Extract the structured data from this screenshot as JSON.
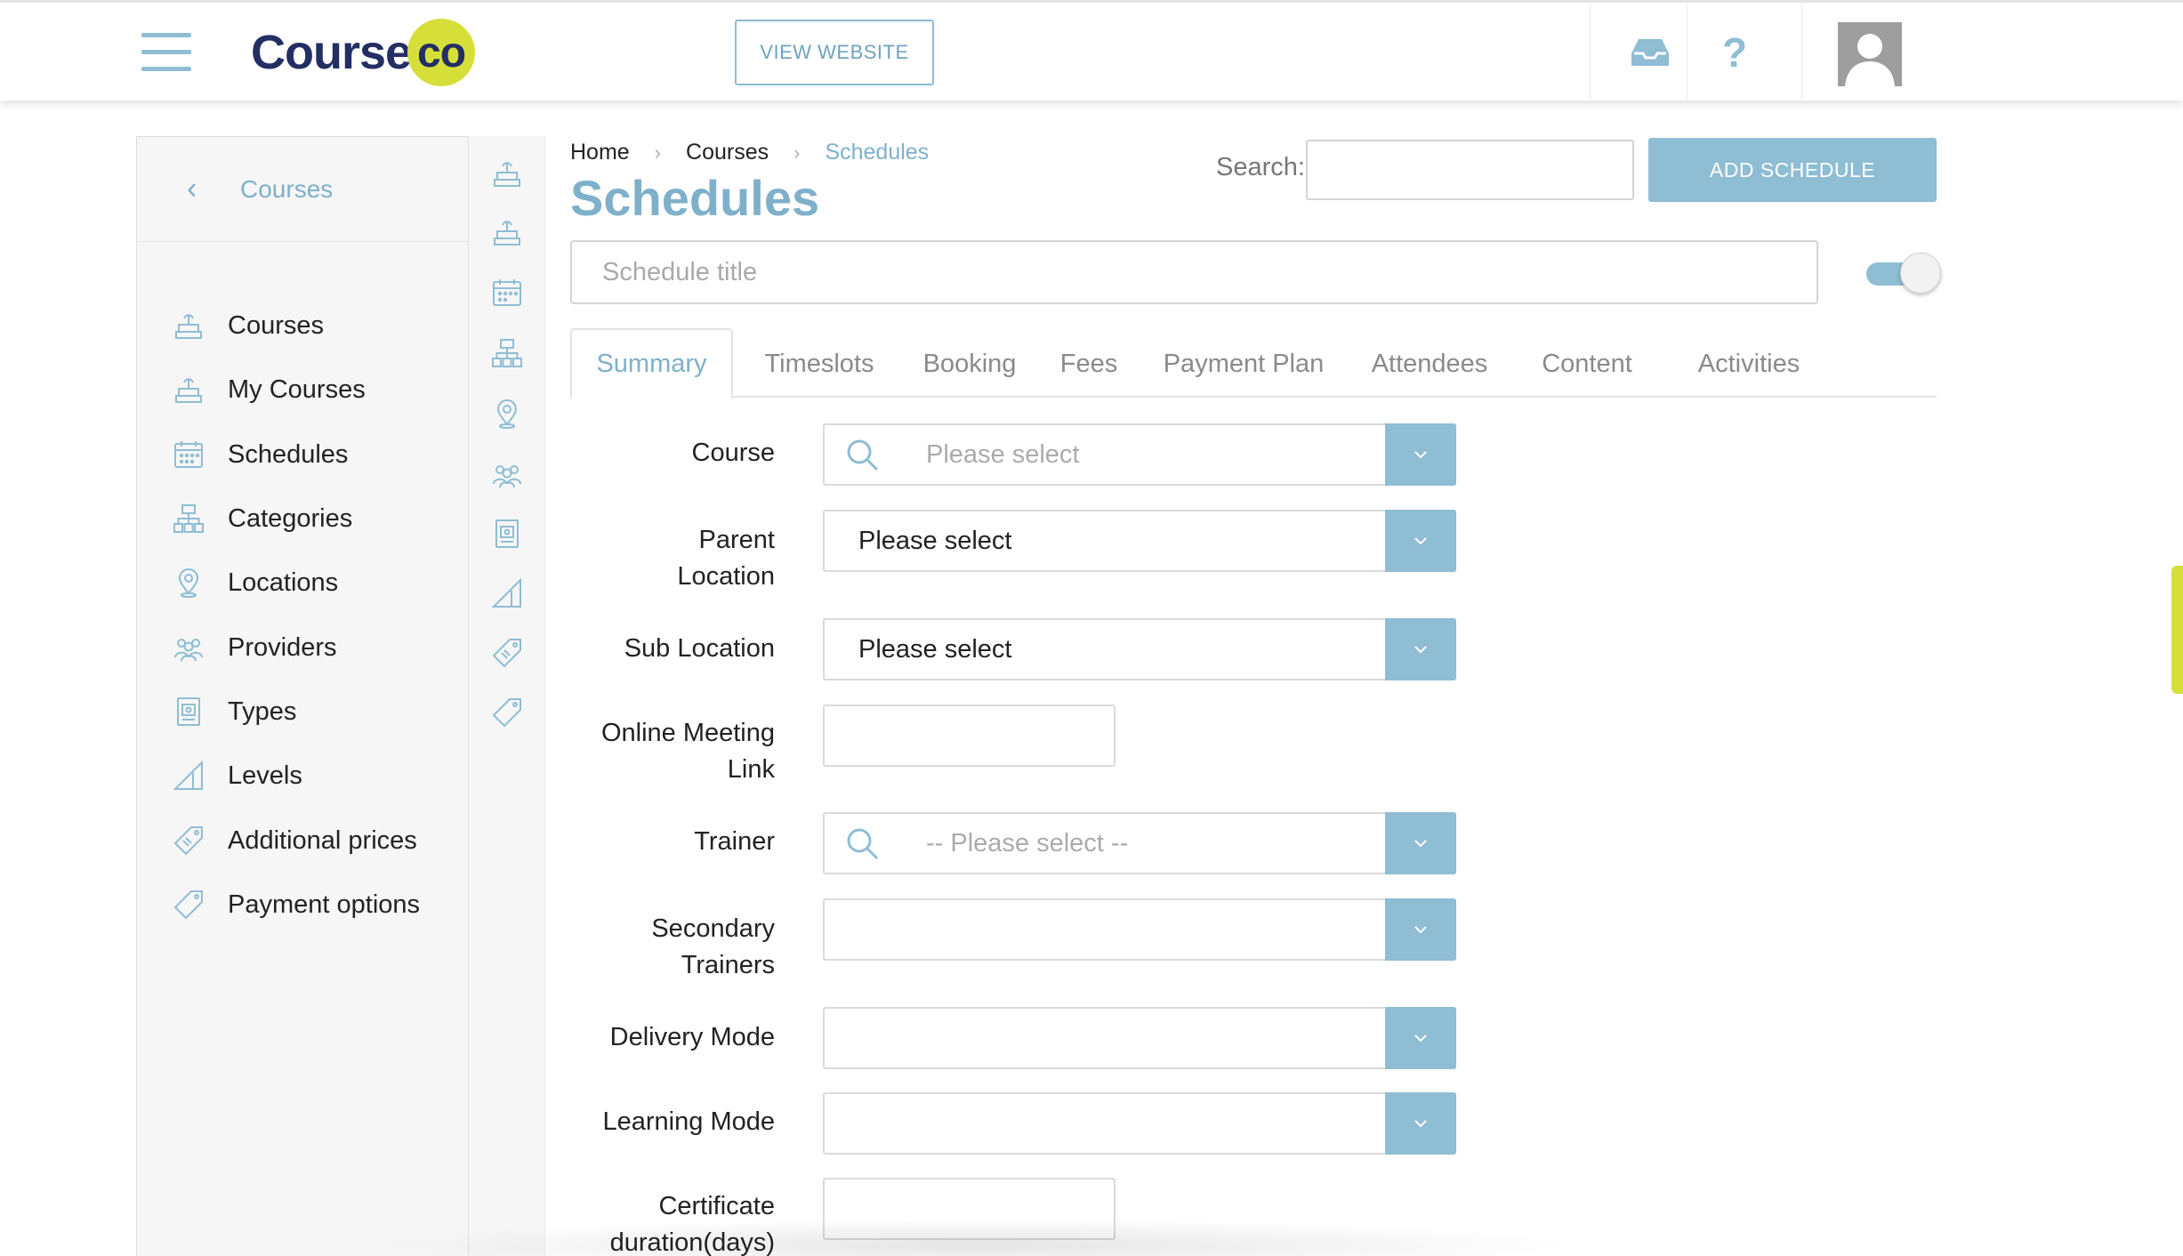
{
  "header": {
    "logo_text": "Course",
    "logo_badge": "co",
    "view_website_label": "VIEW WEBSITE",
    "icons": [
      "menu-icon",
      "inbox-icon",
      "help-icon",
      "user-avatar-icon"
    ],
    "help_glyph": "?"
  },
  "sidebar": {
    "back_label": "Courses",
    "back_glyph": "‹",
    "items": [
      {
        "label": "Courses",
        "icon": "courses-icon"
      },
      {
        "label": "My Courses",
        "icon": "my-courses-icon"
      },
      {
        "label": "Schedules",
        "icon": "calendar-icon"
      },
      {
        "label": "Categories",
        "icon": "categories-icon"
      },
      {
        "label": "Locations",
        "icon": "location-pin-icon"
      },
      {
        "label": "Providers",
        "icon": "providers-icon"
      },
      {
        "label": "Types",
        "icon": "types-icon"
      },
      {
        "label": "Levels",
        "icon": "levels-icon"
      },
      {
        "label": "Additional prices",
        "icon": "price-tag-icon"
      },
      {
        "label": "Payment options",
        "icon": "payment-tag-icon"
      }
    ]
  },
  "breadcrumb": {
    "items": [
      "Home",
      "Courses",
      "Schedules"
    ],
    "separator": "›"
  },
  "page": {
    "title": "Schedules",
    "search_label": "Search:",
    "search_value": "",
    "add_button_label": "ADD SCHEDULE",
    "title_placeholder": "Schedule title",
    "toggle_on": true
  },
  "tabs": [
    {
      "label": "Summary",
      "active": true
    },
    {
      "label": "Timeslots",
      "active": false
    },
    {
      "label": "Booking",
      "active": false
    },
    {
      "label": "Fees",
      "active": false
    },
    {
      "label": "Payment Plan",
      "active": false
    },
    {
      "label": "Attendees",
      "active": false
    },
    {
      "label": "Content",
      "active": false
    },
    {
      "label": "Activities",
      "active": false
    }
  ],
  "form": {
    "course": {
      "label": "Course",
      "placeholder": "Please select"
    },
    "parent_location": {
      "label_line1": "Parent",
      "label_line2": "Location",
      "value": "Please select"
    },
    "sub_location": {
      "label": "Sub Location",
      "value": "Please select"
    },
    "online_meeting_link": {
      "label_line1": "Online Meeting",
      "label_line2": "Link",
      "value": ""
    },
    "trainer": {
      "label": "Trainer",
      "placeholder": "-- Please select --"
    },
    "secondary_trainers": {
      "label_line1": "Secondary",
      "label_line2": "Trainers",
      "value": ""
    },
    "delivery_mode": {
      "label": "Delivery Mode",
      "value": ""
    },
    "learning_mode": {
      "label": "Learning Mode",
      "value": ""
    },
    "certificate_duration": {
      "label_line1": "Certificate",
      "label_line2": "duration(days)",
      "value": ""
    }
  },
  "colors": {
    "accent": "#8fbdd3",
    "accent_text": "#7fb0ca",
    "brand_navy": "#232e63",
    "brand_lime": "#d6df3a"
  }
}
